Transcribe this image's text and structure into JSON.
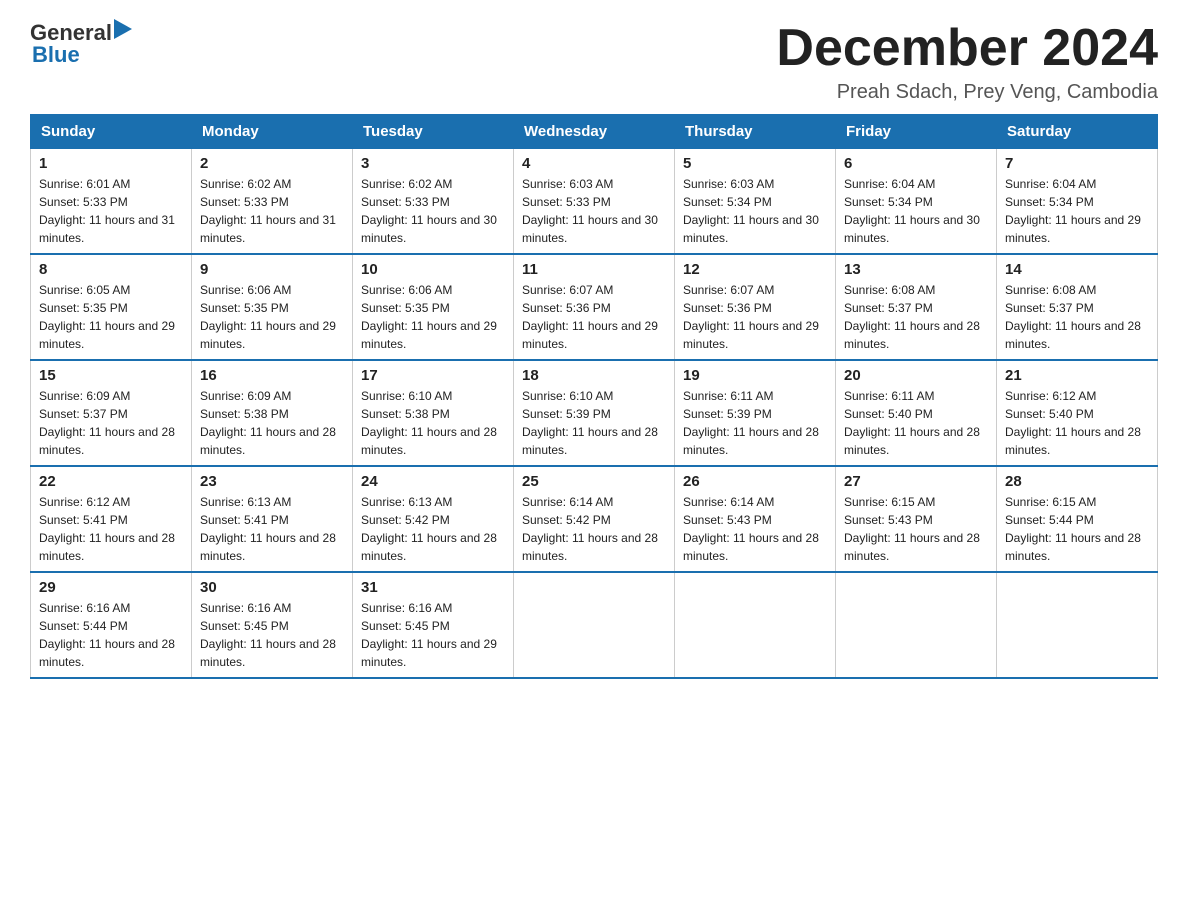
{
  "header": {
    "logo_general": "General",
    "logo_blue": "Blue",
    "month_title": "December 2024",
    "location": "Preah Sdach, Prey Veng, Cambodia"
  },
  "days_of_week": [
    "Sunday",
    "Monday",
    "Tuesday",
    "Wednesday",
    "Thursday",
    "Friday",
    "Saturday"
  ],
  "weeks": [
    [
      {
        "day": "1",
        "sunrise": "6:01 AM",
        "sunset": "5:33 PM",
        "daylight": "11 hours and 31 minutes."
      },
      {
        "day": "2",
        "sunrise": "6:02 AM",
        "sunset": "5:33 PM",
        "daylight": "11 hours and 31 minutes."
      },
      {
        "day": "3",
        "sunrise": "6:02 AM",
        "sunset": "5:33 PM",
        "daylight": "11 hours and 30 minutes."
      },
      {
        "day": "4",
        "sunrise": "6:03 AM",
        "sunset": "5:33 PM",
        "daylight": "11 hours and 30 minutes."
      },
      {
        "day": "5",
        "sunrise": "6:03 AM",
        "sunset": "5:34 PM",
        "daylight": "11 hours and 30 minutes."
      },
      {
        "day": "6",
        "sunrise": "6:04 AM",
        "sunset": "5:34 PM",
        "daylight": "11 hours and 30 minutes."
      },
      {
        "day": "7",
        "sunrise": "6:04 AM",
        "sunset": "5:34 PM",
        "daylight": "11 hours and 29 minutes."
      }
    ],
    [
      {
        "day": "8",
        "sunrise": "6:05 AM",
        "sunset": "5:35 PM",
        "daylight": "11 hours and 29 minutes."
      },
      {
        "day": "9",
        "sunrise": "6:06 AM",
        "sunset": "5:35 PM",
        "daylight": "11 hours and 29 minutes."
      },
      {
        "day": "10",
        "sunrise": "6:06 AM",
        "sunset": "5:35 PM",
        "daylight": "11 hours and 29 minutes."
      },
      {
        "day": "11",
        "sunrise": "6:07 AM",
        "sunset": "5:36 PM",
        "daylight": "11 hours and 29 minutes."
      },
      {
        "day": "12",
        "sunrise": "6:07 AM",
        "sunset": "5:36 PM",
        "daylight": "11 hours and 29 minutes."
      },
      {
        "day": "13",
        "sunrise": "6:08 AM",
        "sunset": "5:37 PM",
        "daylight": "11 hours and 28 minutes."
      },
      {
        "day": "14",
        "sunrise": "6:08 AM",
        "sunset": "5:37 PM",
        "daylight": "11 hours and 28 minutes."
      }
    ],
    [
      {
        "day": "15",
        "sunrise": "6:09 AM",
        "sunset": "5:37 PM",
        "daylight": "11 hours and 28 minutes."
      },
      {
        "day": "16",
        "sunrise": "6:09 AM",
        "sunset": "5:38 PM",
        "daylight": "11 hours and 28 minutes."
      },
      {
        "day": "17",
        "sunrise": "6:10 AM",
        "sunset": "5:38 PM",
        "daylight": "11 hours and 28 minutes."
      },
      {
        "day": "18",
        "sunrise": "6:10 AM",
        "sunset": "5:39 PM",
        "daylight": "11 hours and 28 minutes."
      },
      {
        "day": "19",
        "sunrise": "6:11 AM",
        "sunset": "5:39 PM",
        "daylight": "11 hours and 28 minutes."
      },
      {
        "day": "20",
        "sunrise": "6:11 AM",
        "sunset": "5:40 PM",
        "daylight": "11 hours and 28 minutes."
      },
      {
        "day": "21",
        "sunrise": "6:12 AM",
        "sunset": "5:40 PM",
        "daylight": "11 hours and 28 minutes."
      }
    ],
    [
      {
        "day": "22",
        "sunrise": "6:12 AM",
        "sunset": "5:41 PM",
        "daylight": "11 hours and 28 minutes."
      },
      {
        "day": "23",
        "sunrise": "6:13 AM",
        "sunset": "5:41 PM",
        "daylight": "11 hours and 28 minutes."
      },
      {
        "day": "24",
        "sunrise": "6:13 AM",
        "sunset": "5:42 PM",
        "daylight": "11 hours and 28 minutes."
      },
      {
        "day": "25",
        "sunrise": "6:14 AM",
        "sunset": "5:42 PM",
        "daylight": "11 hours and 28 minutes."
      },
      {
        "day": "26",
        "sunrise": "6:14 AM",
        "sunset": "5:43 PM",
        "daylight": "11 hours and 28 minutes."
      },
      {
        "day": "27",
        "sunrise": "6:15 AM",
        "sunset": "5:43 PM",
        "daylight": "11 hours and 28 minutes."
      },
      {
        "day": "28",
        "sunrise": "6:15 AM",
        "sunset": "5:44 PM",
        "daylight": "11 hours and 28 minutes."
      }
    ],
    [
      {
        "day": "29",
        "sunrise": "6:16 AM",
        "sunset": "5:44 PM",
        "daylight": "11 hours and 28 minutes."
      },
      {
        "day": "30",
        "sunrise": "6:16 AM",
        "sunset": "5:45 PM",
        "daylight": "11 hours and 28 minutes."
      },
      {
        "day": "31",
        "sunrise": "6:16 AM",
        "sunset": "5:45 PM",
        "daylight": "11 hours and 29 minutes."
      },
      null,
      null,
      null,
      null
    ]
  ]
}
